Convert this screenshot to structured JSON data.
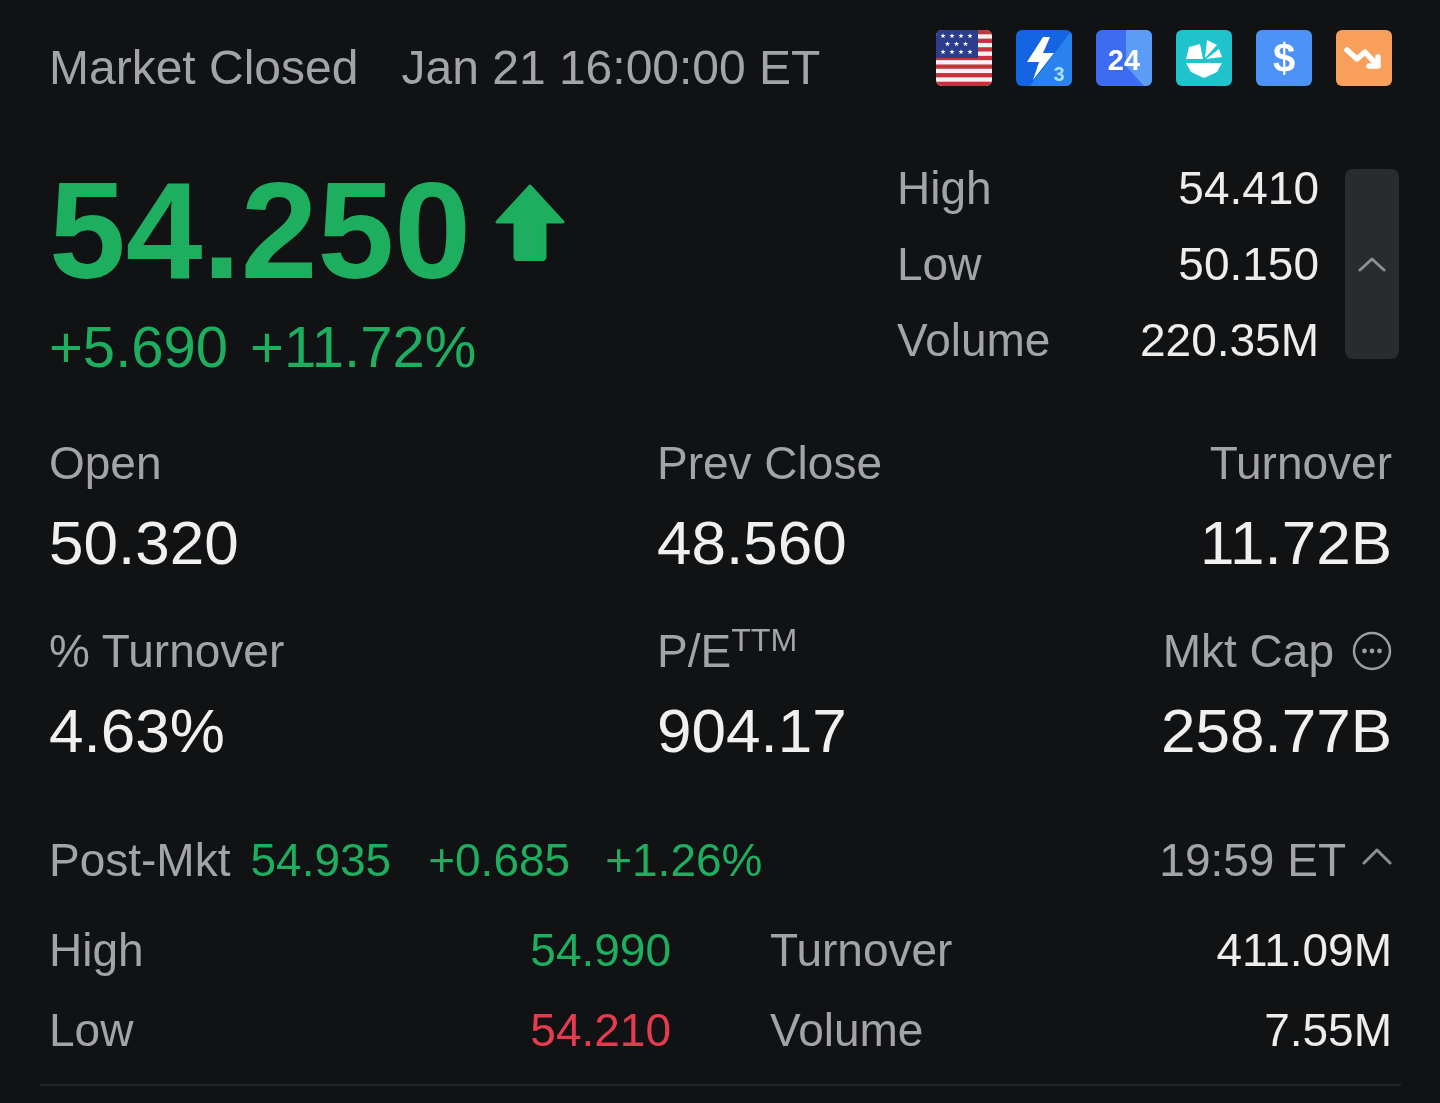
{
  "header": {
    "status": "Market Closed",
    "time": "Jan 21 16:00:00 ET",
    "badges": [
      {
        "kind": "flag"
      },
      {
        "kind": "lightning",
        "label": "3"
      },
      {
        "kind": "hours",
        "label": "24"
      },
      {
        "kind": "pie"
      },
      {
        "kind": "dollar",
        "label": "$"
      },
      {
        "kind": "trend-down"
      }
    ]
  },
  "quote": {
    "price": "54.250",
    "rising": true,
    "change": "+5.690",
    "change_percent": "+11.72%"
  },
  "range": {
    "expanded": true,
    "rows": [
      {
        "label": "High",
        "value": "54.410"
      },
      {
        "label": "Low",
        "value": "50.150"
      },
      {
        "label": "Volume",
        "value": "220.35M"
      }
    ]
  },
  "stats": [
    {
      "label": "Open",
      "value": "50.320",
      "menu": false
    },
    {
      "label": "Prev Close",
      "value": "48.560",
      "menu": false
    },
    {
      "label": "Turnover",
      "value": "11.72B",
      "menu": false
    },
    {
      "label": "% Turnover",
      "value": "4.63%",
      "menu": false
    },
    {
      "label": "P/E$^{TTM}$",
      "value": "904.17",
      "menu": false
    },
    {
      "label": "Mkt Cap",
      "value": "258.77B",
      "menu": true
    }
  ],
  "post_market": {
    "label": "Post-Mkt",
    "price": "54.935",
    "change": "+0.685",
    "change_percent": "+1.26%",
    "rising": true,
    "time": "19:59 ET",
    "expanded": true,
    "rows": [
      {
        "label": "High",
        "value": "54.990",
        "color": "#1dae5f"
      },
      {
        "label": "Turnover",
        "value": "411.09M",
        "color": "#ededed"
      },
      {
        "label": "Low",
        "value": "54.210",
        "color": "#e63b4f"
      },
      {
        "label": "Volume",
        "value": "7.55M",
        "color": "#ededed"
      }
    ]
  }
}
